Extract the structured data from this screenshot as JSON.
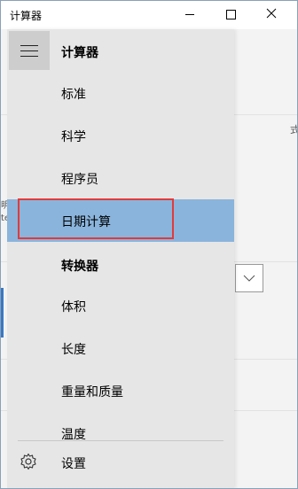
{
  "window": {
    "title": "计算器"
  },
  "background": {
    "right_text": "式",
    "left_a": "明",
    "left_b": "te"
  },
  "nav": {
    "header": "计算器",
    "calculator_items": [
      {
        "label": "标准"
      },
      {
        "label": "科学"
      },
      {
        "label": "程序员"
      },
      {
        "label": "日期计算",
        "selected": true
      }
    ],
    "converter_header": "转换器",
    "converter_items": [
      {
        "label": "体积"
      },
      {
        "label": "长度"
      },
      {
        "label": "重量和质量"
      },
      {
        "label": "温度"
      }
    ],
    "settings_label": "设置"
  },
  "colors": {
    "selected": "#8ab4dc",
    "highlight_border": "#e23a3a",
    "nav_bg": "#e6e6e6"
  }
}
